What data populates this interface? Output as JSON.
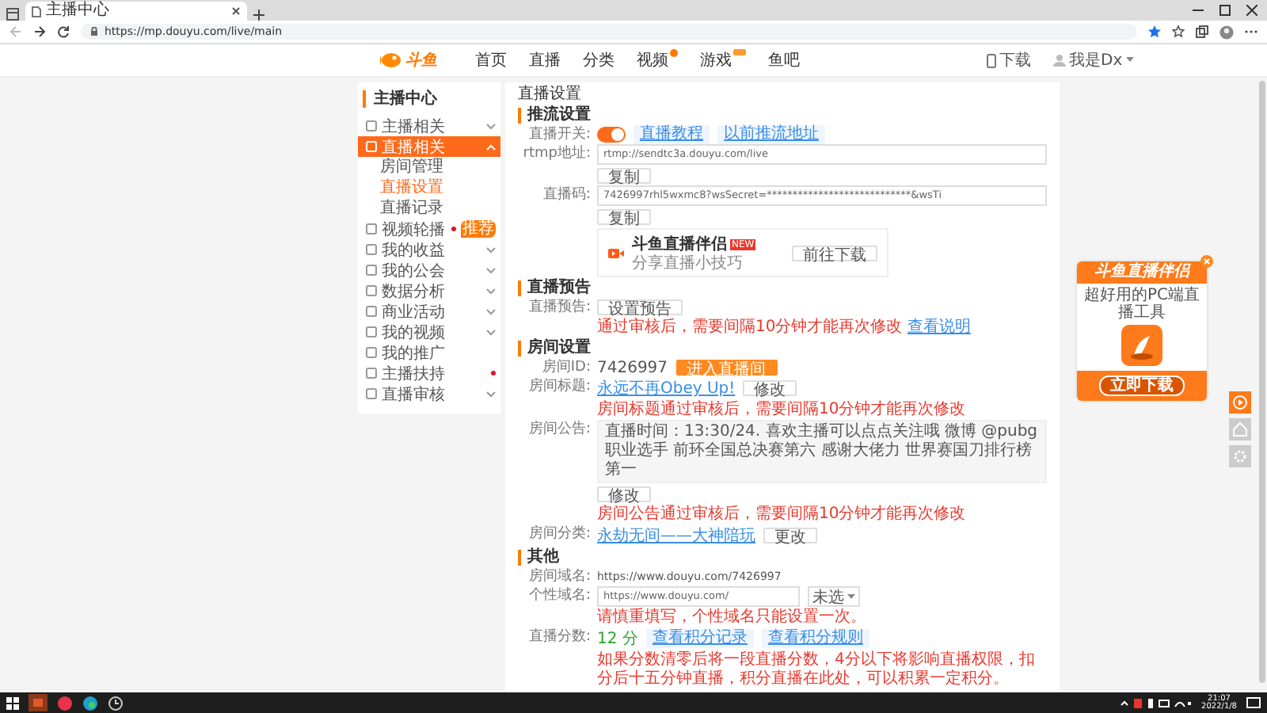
{
  "browser": {
    "tab_title": "主播中心",
    "url": "https://mp.douyu.com/live/main"
  },
  "header": {
    "logo_text": "斗鱼",
    "nav": [
      {
        "label": "首页",
        "dot": false,
        "tag": false
      },
      {
        "label": "直播",
        "dot": false,
        "tag": false
      },
      {
        "label": "分类",
        "dot": false,
        "tag": false
      },
      {
        "label": "视频",
        "dot": true,
        "tag": false
      },
      {
        "label": "游戏",
        "dot": false,
        "tag": true
      },
      {
        "label": "鱼吧",
        "dot": false,
        "tag": false
      }
    ],
    "download": "下载",
    "user": "我是Dx"
  },
  "sidebar": {
    "title": "主播中心",
    "items": [
      {
        "label": "主播相关",
        "kind": "group",
        "selected": false,
        "dot": false
      },
      {
        "label": "直播相关",
        "kind": "group",
        "selected": true,
        "expanded": true,
        "dot": false,
        "children": [
          {
            "label": "房间管理",
            "selected": false
          },
          {
            "label": "直播设置",
            "selected": true
          },
          {
            "label": "直播记录",
            "selected": false
          }
        ]
      },
      {
        "label": "视频轮播",
        "kind": "link",
        "selected": false,
        "dot": true,
        "badge": "推荐"
      },
      {
        "label": "我的收益",
        "kind": "group",
        "selected": false,
        "dot": false
      },
      {
        "label": "我的公会",
        "kind": "group",
        "selected": false,
        "dot": false
      },
      {
        "label": "数据分析",
        "kind": "group",
        "selected": false,
        "dot": false
      },
      {
        "label": "商业活动",
        "kind": "group",
        "selected": false,
        "dot": false
      },
      {
        "label": "我的视频",
        "kind": "group",
        "selected": false,
        "dot": false
      },
      {
        "label": "我的推广",
        "kind": "link",
        "selected": false,
        "dot": false
      },
      {
        "label": "主播扶持",
        "kind": "link",
        "selected": false,
        "dot": true
      },
      {
        "label": "直播审核",
        "kind": "group",
        "selected": false,
        "dot": false
      }
    ]
  },
  "panel": {
    "title": "直播设置",
    "sections": [
      {
        "heading": "推流设置",
        "rows": [
          {
            "kind": "switch",
            "label": "直播开关:",
            "on": true,
            "links": [
              "直播教程",
              "以前推流地址"
            ]
          },
          {
            "kind": "copy",
            "label": "rtmp地址:",
            "value": "rtmp://sendtc3a.douyu.com/live",
            "button": "复制"
          },
          {
            "kind": "copy",
            "label": "直播码:",
            "value": "7426997rhl5wxmc8?wsSecret=****************************&wsTi",
            "button": "复制"
          },
          {
            "kind": "promo",
            "title": "斗鱼直播伴侣",
            "badge": "NEW",
            "subtitle": "分享直播小技巧",
            "button": "前往下载"
          }
        ]
      },
      {
        "heading": "直播预告",
        "rows": [
          {
            "kind": "action",
            "label": "直播预告:",
            "button": "设置预告",
            "note": "通过审核后，需要间隔10分钟才能再次修改",
            "note_link": "查看说明"
          }
        ]
      },
      {
        "heading": "房间设置",
        "rows": [
          {
            "kind": "id",
            "label": "房间ID:",
            "value": "7426997",
            "button": "进入直播间"
          },
          {
            "kind": "link_edit",
            "label": "房间标题:",
            "link": "永远不再Obey Up!",
            "button": "修改",
            "note": "房间标题通过审核后，需要间隔10分钟才能再次修改"
          },
          {
            "kind": "notice",
            "label": "房间公告:",
            "value": "直播时间：13:30/24. 喜欢主播可以点点关注哦 微博 @pubg职业选手 前环全国总决赛第六 感谢大佬力 世界赛国刀排行榜第一",
            "button": "修改",
            "note": "房间公告通过审核后，需要间隔10分钟才能再次修改"
          },
          {
            "kind": "link_edit",
            "label": "房间分类:",
            "link": "永劫无间——大神陪玩",
            "button": "更改"
          }
        ]
      },
      {
        "heading": "其他",
        "rows": [
          {
            "kind": "text",
            "label": "房间域名:",
            "value": "https://www.douyu.com/7426997"
          },
          {
            "kind": "domain",
            "label": "个性域名:",
            "value": "https://www.douyu.com/",
            "select": "未选",
            "note": "请慎重填写，个性域名只能设置一次。"
          },
          {
            "kind": "score",
            "label": "直播分数:",
            "score": "12",
            "unit": "分",
            "buttons": [
              "查看积分记录",
              "查看积分规则"
            ],
            "note": "如果分数清零后将一段直播分数，4分以下将影响直播权限，扣分后十五分钟直播，积分直播在此处，可以积累一定积分。"
          }
        ]
      }
    ]
  },
  "widget": {
    "title": "斗鱼直播伴侣",
    "subtitle": "超好用的PC端直播工具",
    "button": "立即下载"
  },
  "taskbar": {
    "time": "21:07",
    "date": "2022/1/8"
  }
}
